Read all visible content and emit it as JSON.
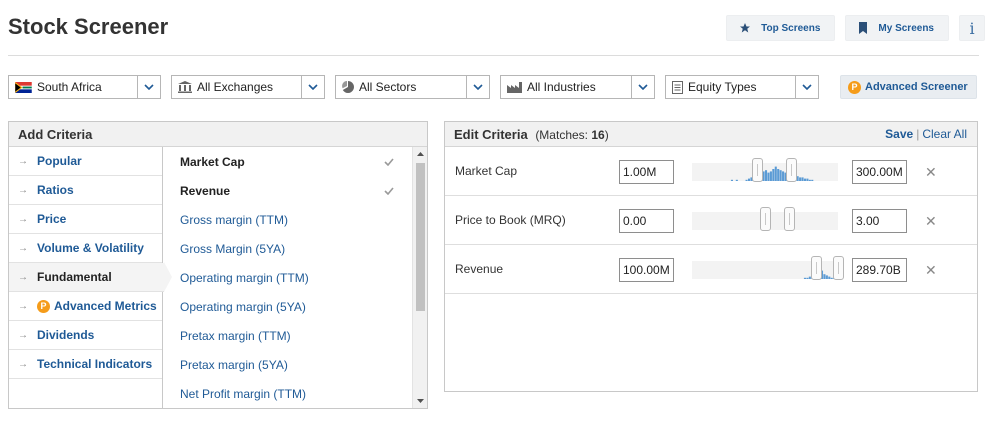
{
  "page": {
    "title": "Stock Screener"
  },
  "top_actions": {
    "top_screens": "Top Screens",
    "my_screens": "My Screens",
    "info": "i"
  },
  "filters": {
    "country": "South Africa",
    "exchanges": "All Exchanges",
    "sectors": "All Sectors",
    "industries": "All Industries",
    "equity_types": "Equity Types",
    "advanced_screener": "Advanced Screener",
    "premium_badge": "P"
  },
  "add_criteria": {
    "title": "Add Criteria",
    "categories": [
      {
        "label": "Popular"
      },
      {
        "label": "Ratios"
      },
      {
        "label": "Price"
      },
      {
        "label": "Volume & Volatility"
      },
      {
        "label": "Fundamental"
      },
      {
        "label": "Advanced Metrics"
      },
      {
        "label": "Dividends"
      },
      {
        "label": "Technical Indicators"
      }
    ],
    "active_category": "Fundamental",
    "criteria": [
      {
        "label": "Market Cap",
        "selected": true
      },
      {
        "label": "Revenue",
        "selected": true
      },
      {
        "label": "Gross margin (TTM)",
        "selected": false
      },
      {
        "label": "Gross Margin (5YA)",
        "selected": false
      },
      {
        "label": "Operating margin (TTM)",
        "selected": false
      },
      {
        "label": "Operating margin (5YA)",
        "selected": false
      },
      {
        "label": "Pretax margin (TTM)",
        "selected": false
      },
      {
        "label": "Pretax margin (5YA)",
        "selected": false
      },
      {
        "label": "Net Profit margin (TTM)",
        "selected": false
      }
    ]
  },
  "edit_criteria": {
    "title": "Edit Criteria",
    "matches_label": "(Matches:",
    "matches_count": "16",
    "matches_close": ")",
    "save": "Save",
    "separator": "|",
    "clear_all": "Clear All",
    "rows": [
      {
        "label": "Market Cap",
        "min": "1.00M",
        "max": "300.00M",
        "range": [
          0.45,
          0.68
        ]
      },
      {
        "label": "Price to Book (MRQ)",
        "min": "0.00",
        "max": "3.00",
        "range": [
          0.5,
          0.67
        ]
      },
      {
        "label": "Revenue",
        "min": "100.00M",
        "max": "289.70B",
        "range": [
          0.85,
          1.0
        ]
      }
    ]
  },
  "colors": {
    "link": "#1f5a96",
    "histogram": "#5b9bd5",
    "premium": "#f59c1a"
  }
}
